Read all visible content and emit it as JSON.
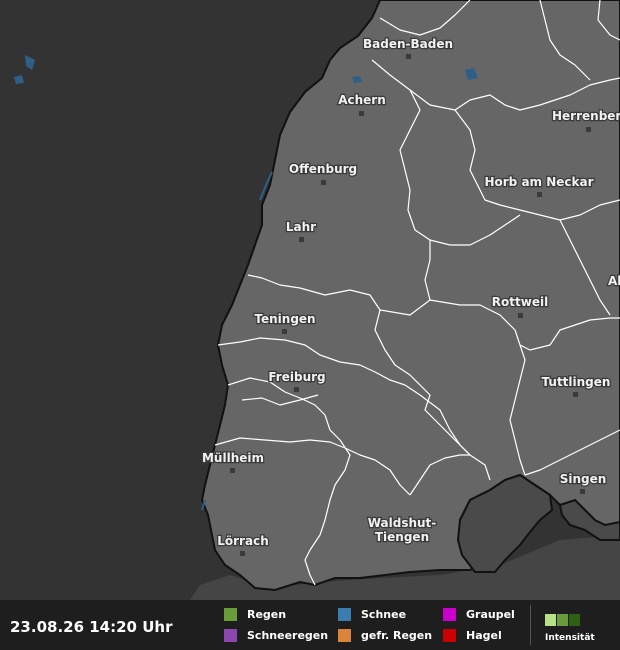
{
  "map": {
    "cities": [
      {
        "name": "Baden-Baden"
      },
      {
        "name": "Achern"
      },
      {
        "name": "Herrenberg"
      },
      {
        "name": "Offenburg"
      },
      {
        "name": "Horb am Neckar"
      },
      {
        "name": "Lahr"
      },
      {
        "name": "Rottweil"
      },
      {
        "name": "Teningen"
      },
      {
        "name": "Freiburg"
      },
      {
        "name": "Tuttlingen"
      },
      {
        "name": "Müllheim"
      },
      {
        "name": "Singen"
      },
      {
        "name": "Lörrach"
      },
      {
        "name": "Waldshut-",
        "name2": "Tiengen"
      },
      {
        "name": "Al"
      }
    ],
    "colors": {
      "background": "#333333",
      "land": "#666666",
      "foreign_land": "#4a4a4a",
      "borders": "#ffffff",
      "water": "#2f5f86"
    }
  },
  "legend": {
    "timestamp": "23.08.26 14:20 Uhr",
    "items": [
      {
        "label": "Regen",
        "color": "#6a9c3a"
      },
      {
        "label": "Schneeregen",
        "color": "#8a47b0"
      },
      {
        "label": "Schnee",
        "color": "#3a7db0"
      },
      {
        "label": "gefr. Regen",
        "color": "#d9843a"
      },
      {
        "label": "Graupel",
        "color": "#cc00cc"
      },
      {
        "label": "Hagel",
        "color": "#cc0000"
      }
    ],
    "intensity_label": "Intensität",
    "intensity_colors": [
      "#b8e08a",
      "#6a9c3a",
      "#2f5f12"
    ]
  }
}
